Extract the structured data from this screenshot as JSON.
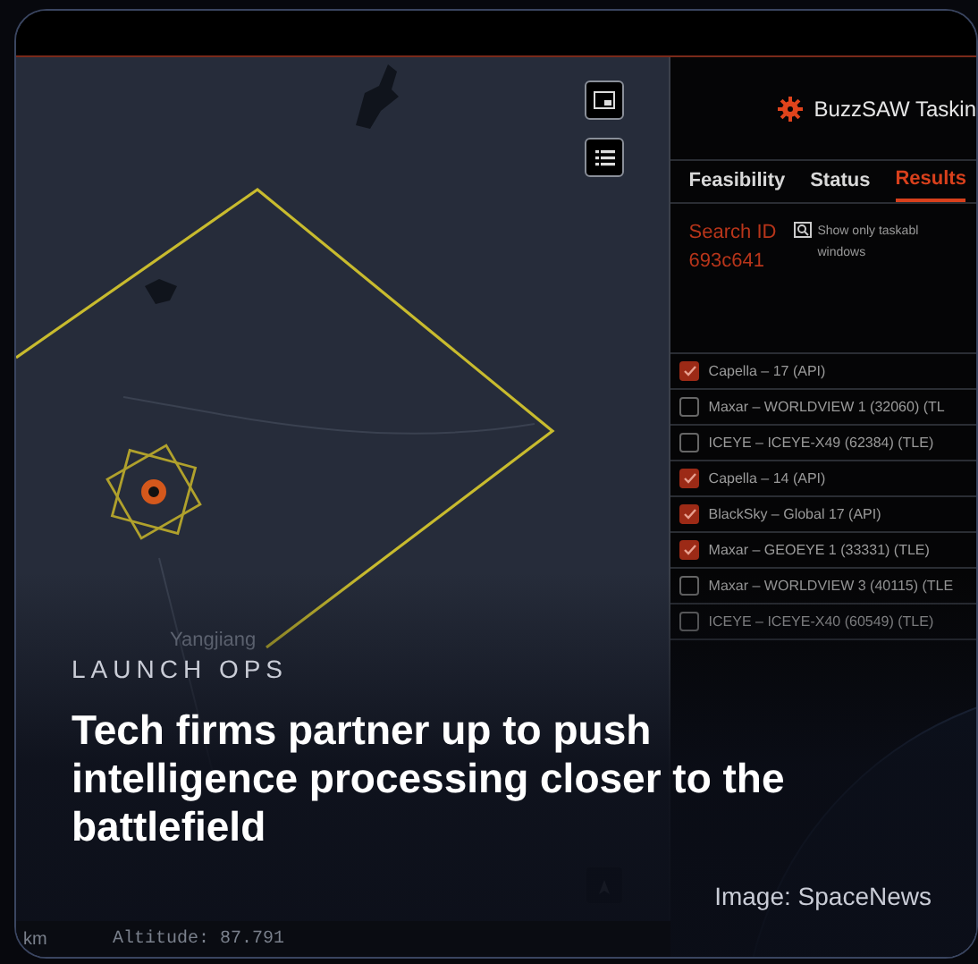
{
  "screenshot": {
    "map": {
      "place_label": "Yangjiang",
      "unit": "km",
      "altitude": "Altitude: 87.791",
      "target": {
        "color": "#d4581c"
      }
    },
    "panel": {
      "title": "BuzzSAW Taskin",
      "tabs": [
        {
          "label": "Feasibility",
          "selected": false
        },
        {
          "label": "Status",
          "selected": false
        },
        {
          "label": "Results",
          "selected": true
        }
      ],
      "search_id_label": "Search ID",
      "search_id": "693c641",
      "filter_lines": [
        "Show only taskabl",
        "windows"
      ],
      "satellites": [
        {
          "name": "Capella – 17 (API)",
          "checked": true
        },
        {
          "name": "Maxar – WORLDVIEW 1 (32060) (TL",
          "checked": false
        },
        {
          "name": "ICEYE – ICEYE-X49 (62384) (TLE)",
          "checked": false
        },
        {
          "name": "Capella – 14 (API)",
          "checked": true
        },
        {
          "name": "BlackSky – Global 17 (API)",
          "checked": true
        },
        {
          "name": "Maxar – GEOEYE 1 (33331) (TLE)",
          "checked": true
        },
        {
          "name": "Maxar – WORLDVIEW 3 (40115) (TLE",
          "checked": false
        },
        {
          "name": "ICEYE – ICEYE-X40 (60549) (TLE)",
          "checked": false
        }
      ]
    }
  },
  "article": {
    "category": "LAUNCH OPS",
    "headline": "Tech firms partner up to push intelligence processing closer to the battlefield",
    "credit": "Image: SpaceNews"
  }
}
